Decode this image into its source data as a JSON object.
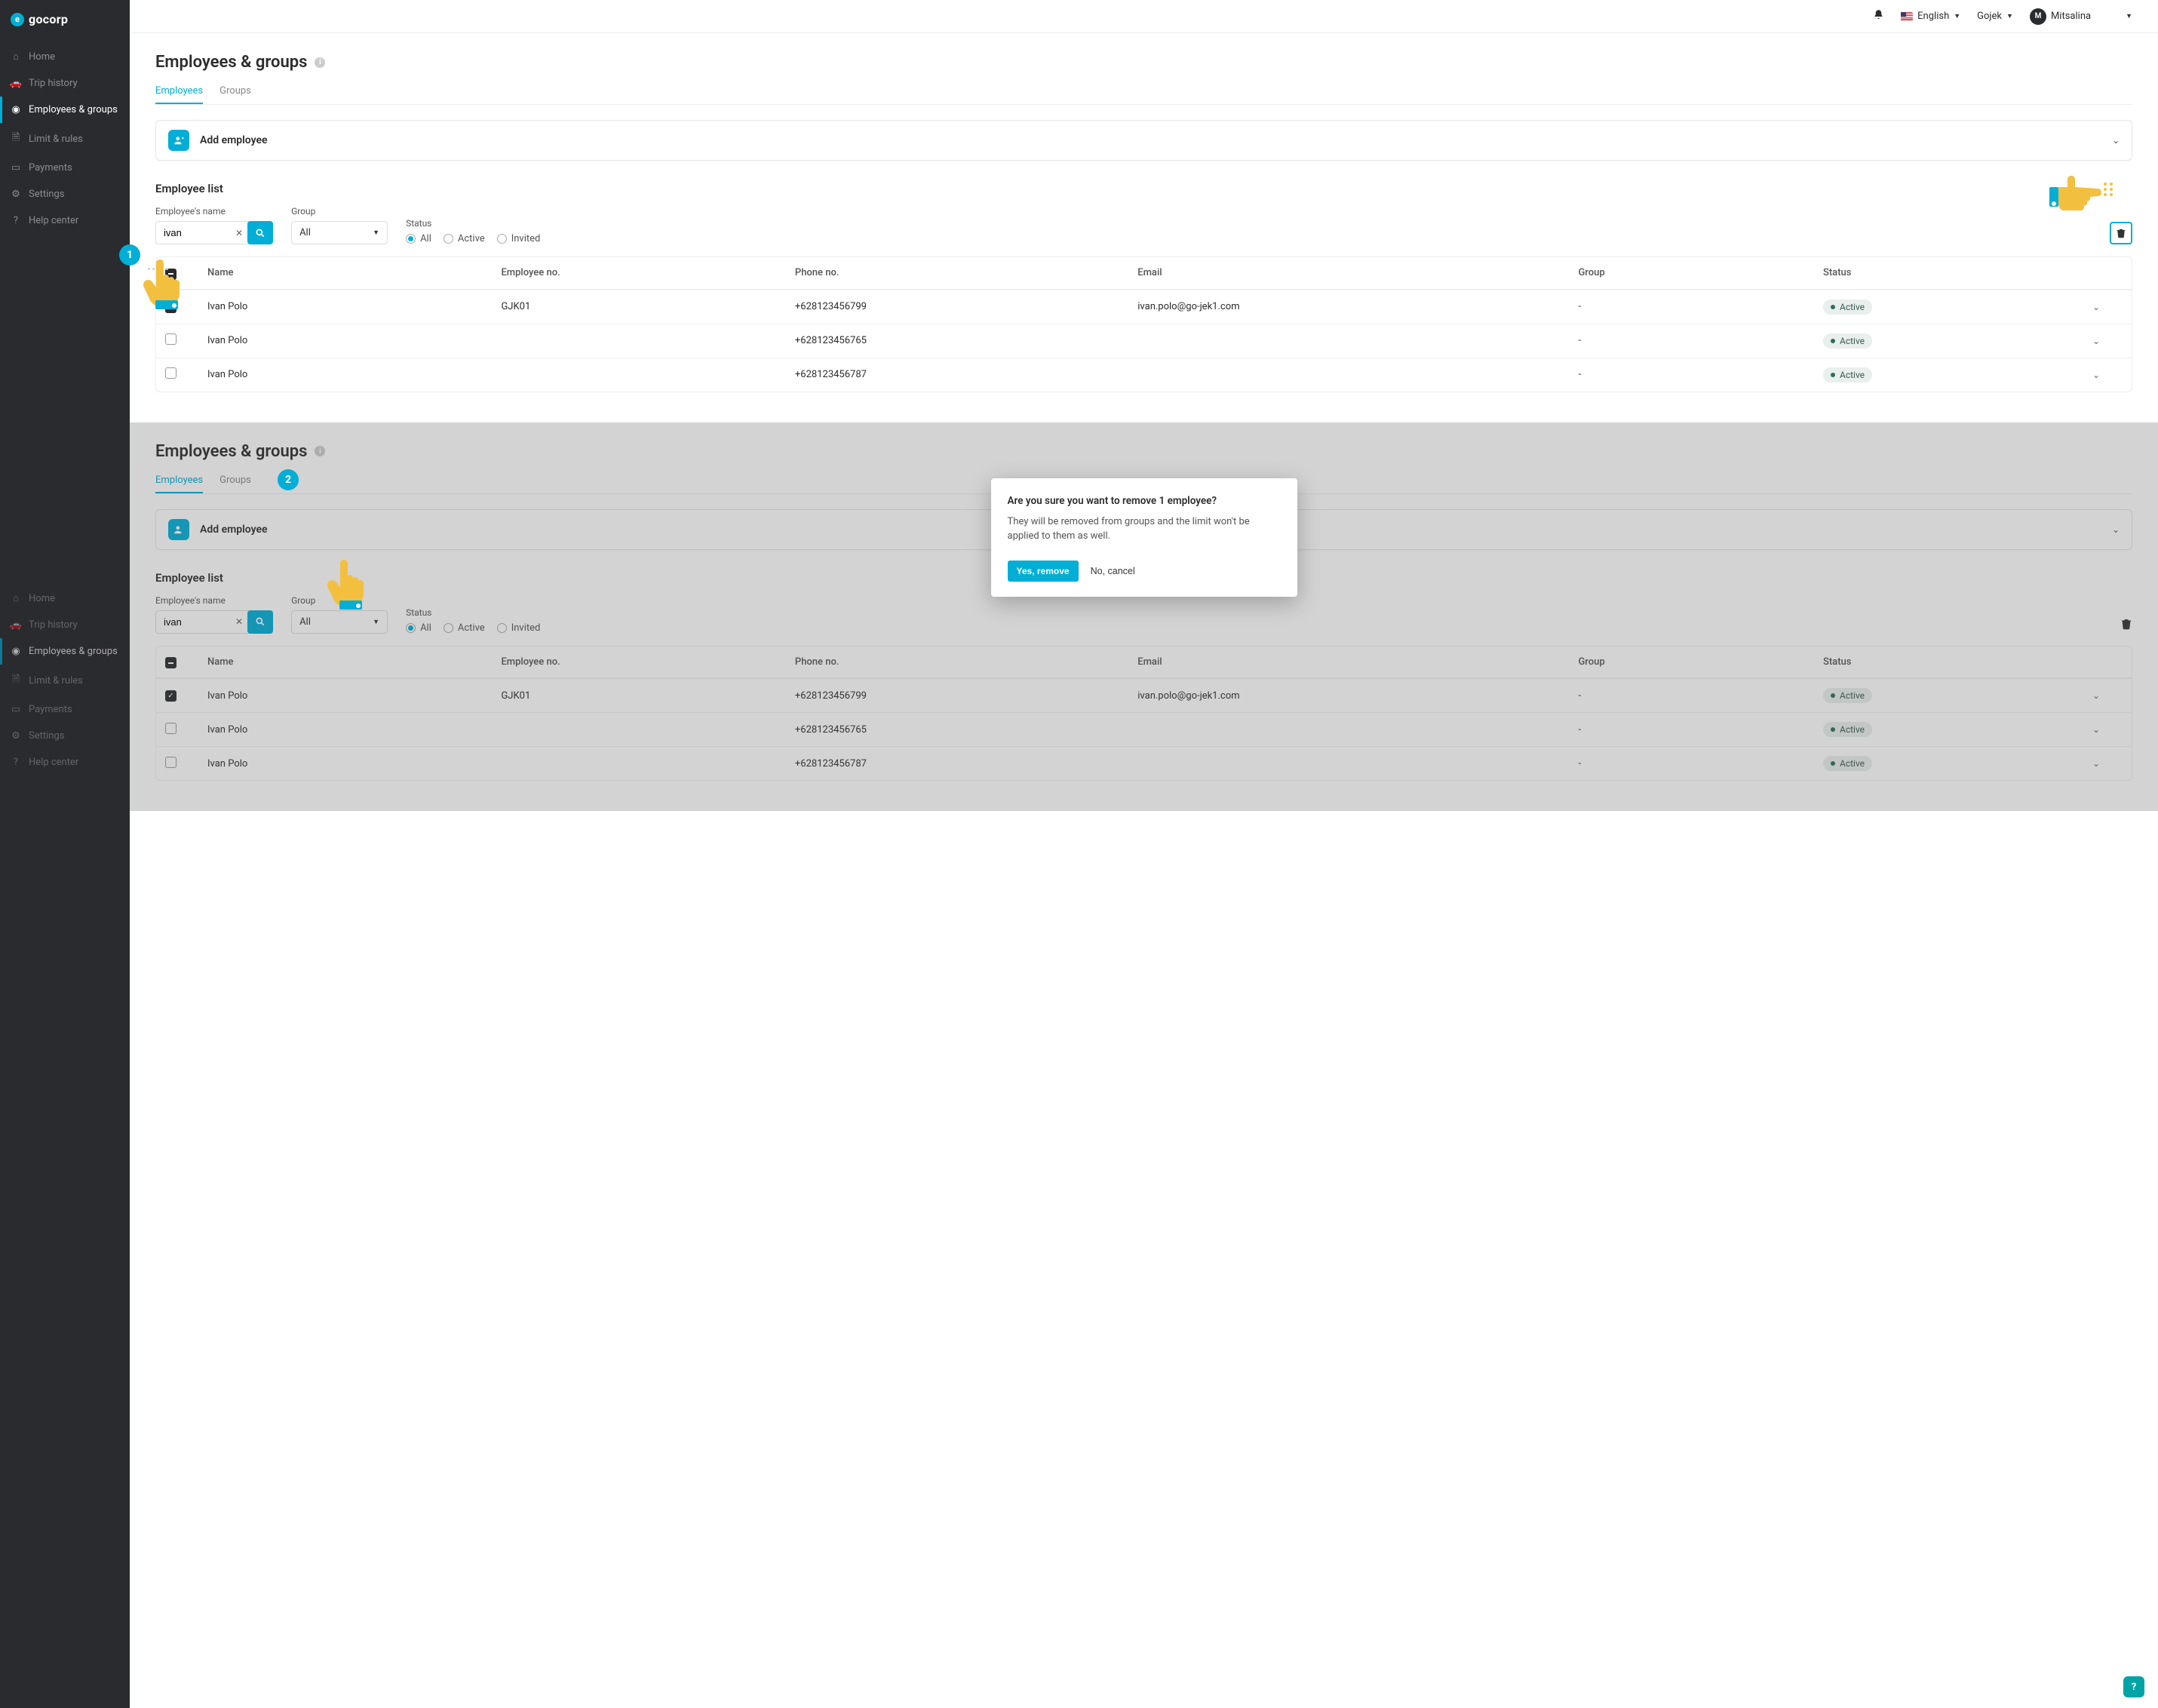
{
  "brand": "gocorp",
  "sidebar": {
    "items": [
      {
        "label": "Home",
        "icon": "home-icon",
        "active": false
      },
      {
        "label": "Trip history",
        "icon": "car-icon",
        "active": false
      },
      {
        "label": "Employees & groups",
        "icon": "user-icon",
        "active": true
      },
      {
        "label": "Limit & rules",
        "icon": "file-icon",
        "active": false
      },
      {
        "label": "Payments",
        "icon": "card-icon",
        "active": false
      },
      {
        "label": "Settings",
        "icon": "sliders-icon",
        "active": false
      },
      {
        "label": "Help center",
        "icon": "help-icon",
        "active": false
      }
    ]
  },
  "topbar": {
    "language": "English",
    "org": "Gojek",
    "user_initial": "M",
    "user_name": "Mitsalina"
  },
  "page": {
    "title": "Employees & groups",
    "tabs": [
      {
        "label": "Employees",
        "active": true
      },
      {
        "label": "Groups",
        "active": false
      }
    ],
    "accordion_label": "Add employee",
    "list_title": "Employee list",
    "filters": {
      "name_label": "Employee's name",
      "name_value": "ivan",
      "group_label": "Group",
      "group_value": "All",
      "status_label": "Status",
      "status_options": [
        "All",
        "Active",
        "Invited"
      ],
      "status_selected": "All"
    },
    "table": {
      "headers": {
        "name": "Name",
        "emp_no": "Employee no.",
        "phone": "Phone no.",
        "email": "Email",
        "group": "Group",
        "status": "Status"
      },
      "rows": [
        {
          "checked": true,
          "name": "Ivan Polo",
          "emp_no": "GJK01",
          "phone": "+628123456799",
          "email": "ivan.polo@go-jek1.com",
          "group": "-",
          "status": "Active"
        },
        {
          "checked": false,
          "name": "Ivan Polo",
          "emp_no": "",
          "phone": "+628123456765",
          "email": "",
          "group": "-",
          "status": "Active"
        },
        {
          "checked": false,
          "name": "Ivan Polo",
          "emp_no": "",
          "phone": "+628123456787",
          "email": "",
          "group": "-",
          "status": "Active"
        }
      ]
    }
  },
  "steps": {
    "one": "1",
    "two": "2"
  },
  "modal": {
    "title": "Are you sure you want to remove 1 employee?",
    "body": "They will be removed from groups and the limit won't be applied to them as well.",
    "confirm": "Yes, remove",
    "cancel": "No, cancel"
  },
  "colors": {
    "accent": "#00aed6",
    "badge": "#f3bf3f"
  }
}
